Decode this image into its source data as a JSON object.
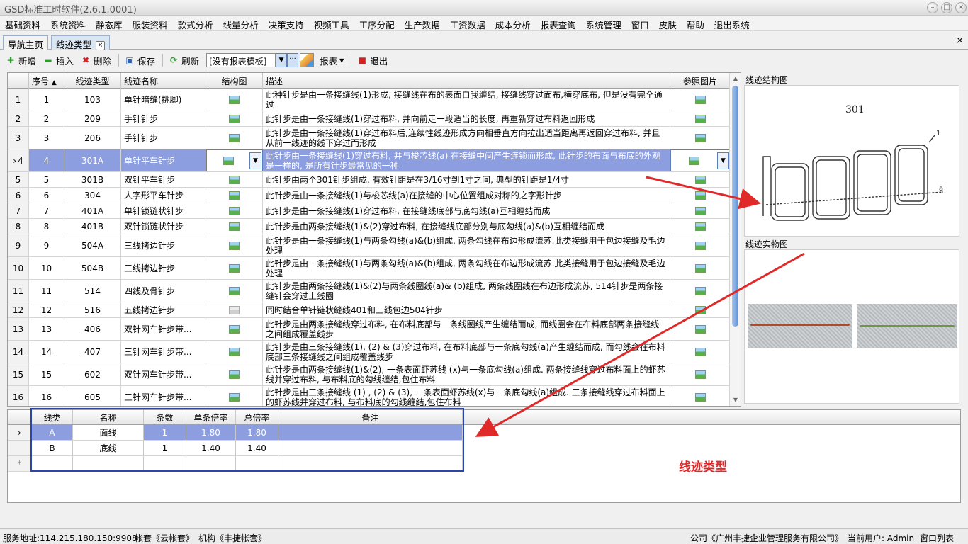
{
  "window": {
    "title": "GSD标准工时软件(2.6.1.0001)",
    "min": "–",
    "max": "□",
    "close": "×"
  },
  "menu": [
    "基础资料",
    "系统资料",
    "静态库",
    "服装资料",
    "款式分析",
    "线量分析",
    "决策支持",
    "视频工具",
    "工序分配",
    "生产数据",
    "工资数据",
    "成本分析",
    "报表查询",
    "系统管理",
    "窗口",
    "皮肤",
    "帮助",
    "退出系统"
  ],
  "tabs": {
    "home": "导航主页",
    "active": "线迹类型",
    "close": "×",
    "x": "×"
  },
  "toolbar": {
    "add": "新增",
    "insert": "插入",
    "delete": "删除",
    "save": "保存",
    "refresh": "刷新",
    "template": "[没有报表模板]",
    "report": "报表",
    "exit": "退出"
  },
  "grid": {
    "headers": {
      "seq": "序号",
      "type": "线迹类型",
      "name": "线迹名称",
      "struct": "结构图",
      "desc": "描述",
      "ref": "参照图片"
    },
    "rows": [
      {
        "rh": "1",
        "seq": "1",
        "type": "103",
        "name": "单针暗缝(挑脚)",
        "desc": "此种针步是由一条接缝线(1)形成, 接缝线在布的表面自我缠结, 接缝线穿过面布,横穿底布, 但是没有完全通过"
      },
      {
        "rh": "2",
        "seq": "2",
        "type": "209",
        "name": "手针针步",
        "desc": "此针步是由一条接缝线(1)穿过布料, 并向前走一段适当的长度, 再重新穿过布料返回形成"
      },
      {
        "rh": "3",
        "seq": "3",
        "type": "206",
        "name": "手针针步",
        "desc": "此针步是由一条接缝线(1)穿过布料后,连续性线迹形成方向相垂直方向拉出适当距离再返回穿过布料, 并且从前一线迹的线下穿过而形成"
      },
      {
        "rh": "4",
        "seq": "4",
        "type": "301A",
        "name": "单针平车针步",
        "desc": "此针步由一条接缝线(1)穿过布料, 并与梭芯线(a) 在接缝中间产生连锁而形成, 此针步的布面与布底的外观是一样的, 是所有针步最常见的一种"
      },
      {
        "rh": "5",
        "seq": "5",
        "type": "301B",
        "name": "双针平车针步",
        "desc": "此针步由两个301针步组成, 有效针距是在3/16寸到1寸之间, 典型的针距是1/4寸"
      },
      {
        "rh": "6",
        "seq": "6",
        "type": "304",
        "name": "人字形平车针步",
        "desc": "此针步是由一条接缝线(1)与梭芯线(a)在接缝的中心位置组成对称的之字形针步"
      },
      {
        "rh": "7",
        "seq": "7",
        "type": "401A",
        "name": "单针锁链状针步",
        "desc": "此针步是由一条接缝线(1)穿过布料, 在接缝线底部与底勾线(a)互相缠结而成"
      },
      {
        "rh": "8",
        "seq": "8",
        "type": "401B",
        "name": "双针锁链状针步",
        "desc": "此针步是由两条接缝线(1)&(2)穿过布料, 在接缝线底部分别与底勾线(a)&(b)互相缠结而成"
      },
      {
        "rh": "9",
        "seq": "9",
        "type": "504A",
        "name": "三线拷边针步",
        "desc": "此针步是由一条接缝线(1)与两条勾线(a)&(b)组成, 两条勾线在布边形成流苏.此类接缝用于包边接缝及毛边处理"
      },
      {
        "rh": "10",
        "seq": "10",
        "type": "504B",
        "name": "三线拷边针步",
        "desc": "此针步是由一条接缝线(1)与两条勾线(a)&(b)组成, 两条勾线在布边形成流苏.此类接缝用于包边接缝及毛边处理"
      },
      {
        "rh": "11",
        "seq": "11",
        "type": "514",
        "name": "四线及骨针步",
        "desc": "此针步是由两条接缝线(1)&(2)与两条线圈线(a)& (b)组成, 两条线圈线在布边形成流苏, 514针步是两条接缝针会穿过上线圈"
      },
      {
        "rh": "12",
        "seq": "12",
        "type": "516",
        "name": "五线拷边针步",
        "desc": "同时结合单针链状缝线401和三线包边504针步"
      },
      {
        "rh": "13",
        "seq": "13",
        "type": "406",
        "name": "双针网车针步带...",
        "desc": "此针步是由两条接缝线穿过布料, 在布料底部与一条线圈线产生缠结而成, 而线圈会在布料底部两条接缝线之间组成覆盖线步"
      },
      {
        "rh": "14",
        "seq": "14",
        "type": "407",
        "name": "三针网车针步带...",
        "desc": "此针步是由三条接缝线(1), (2) & (3)穿过布料, 在布料底部与一条底勾线(a)产生缠结而成, 而勾线会在布料底部三条接缝线之间组成覆盖线步"
      },
      {
        "rh": "15",
        "seq": "15",
        "type": "602",
        "name": "双针网车针步带...",
        "desc": "此针步是由两条接缝线(1)&(2), 一条表面虾苏线 (x)与一条底勾线(a)组成. 两条接缝线穿过布料面上的虾苏线并穿过布料, 与布料底的勾线缠结,包住布料"
      },
      {
        "rh": "16",
        "seq": "16",
        "type": "605",
        "name": "三针网车针步带...",
        "desc": "此针步是由三条接缝线 (1) , (2) & (3), 一条表面虾苏线(x)与一条底勾线(a)组成. 三条接缝线穿过布料面上的虾苏线并穿过布料, 与布料底的勾线缠结,包住布料"
      }
    ]
  },
  "right_panel": {
    "struct_label": "线迹结构图",
    "struct_code": "301",
    "struct_mark1": "1",
    "struct_mark2": "a",
    "photo_label": "线迹实物图"
  },
  "subgrid": {
    "headers": {
      "type": "线类",
      "name": "名称",
      "count": "条数",
      "single": "单条倍率",
      "total": "总倍率",
      "note": "备注"
    },
    "rows": [
      {
        "type": "A",
        "name": "面线",
        "count": "1",
        "single": "1.80",
        "total": "1.80",
        "note": ""
      },
      {
        "type": "B",
        "name": "底线",
        "count": "1",
        "single": "1.40",
        "total": "1.40",
        "note": ""
      }
    ],
    "new_row_marker": "*"
  },
  "annotation": {
    "label": "线迹类型",
    "color": "#e02a2a"
  },
  "status": {
    "server": "服务地址:114.215.180.150:9908",
    "account": "帐套《云帐套》",
    "org": "机构《丰捷帐套》",
    "company": "公司《广州丰捷企业管理服务有限公司》",
    "user": "当前用户: Admin",
    "windows": "窗口列表"
  },
  "colors": {
    "selection": "#8c9ee0",
    "scroll_thumb": "#5c8fd6",
    "frame_blue": "#2b46a8"
  }
}
